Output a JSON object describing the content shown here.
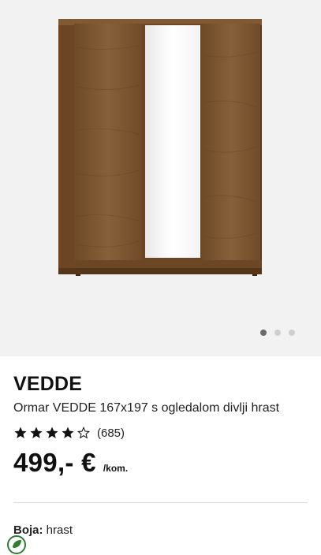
{
  "gallery": {
    "image_alt": "Ormar VEDDE 167x197 s ogledalom",
    "slides": 3,
    "active_slide": 1
  },
  "product": {
    "brand": "VEDDE",
    "subtitle": "Ormar VEDDE 167x197 s ogledalom divlji hrast",
    "rating": 4,
    "rating_max": 5,
    "reviews": "(685)",
    "price": "499,- €",
    "price_unit": "/kom.",
    "color_label": "Boja:",
    "color_value": "hrast"
  },
  "colors": {
    "background": "#f2f2f2",
    "wood": "#7a5530",
    "text": "#111111"
  },
  "icons": [
    "star-icon",
    "star-outline-icon",
    "eco-leaf-icon"
  ]
}
